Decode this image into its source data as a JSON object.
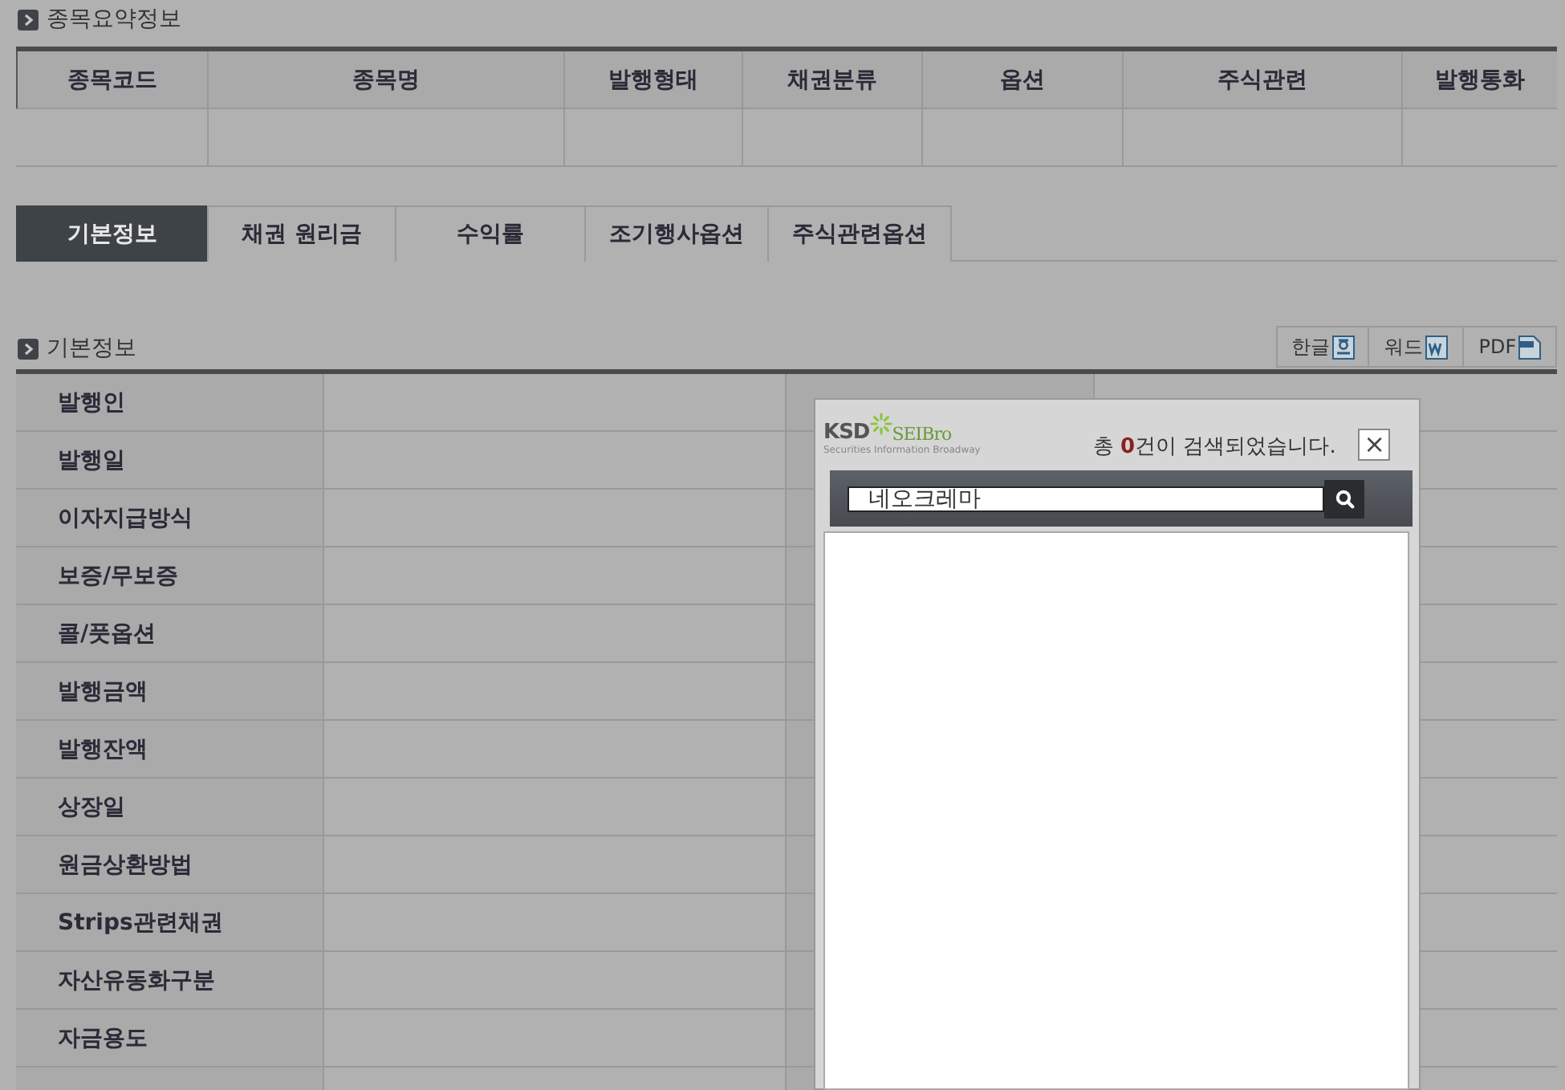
{
  "summary": {
    "title": "종목요약정보",
    "columns": [
      "종목코드",
      "종목명",
      "발행형태",
      "채권분류",
      "옵션",
      "주식관련",
      "발행통화"
    ]
  },
  "tabs": [
    {
      "label": "기본정보",
      "selected": true
    },
    {
      "label": "채권 원리금",
      "selected": false
    },
    {
      "label": "수익률",
      "selected": false
    },
    {
      "label": "조기행사옵션",
      "selected": false
    },
    {
      "label": "주식관련옵션",
      "selected": false
    }
  ],
  "basic_info": {
    "title": "기본정보",
    "exports": [
      {
        "label": "한글",
        "kind": "hwp"
      },
      {
        "label": "워드",
        "kind": "word"
      },
      {
        "label": "PDF",
        "kind": "pdf"
      }
    ],
    "rows": [
      {
        "label": "발행인"
      },
      {
        "label": "발행일"
      },
      {
        "label": "이자지급방식"
      },
      {
        "label": "보증/무보증"
      },
      {
        "label": "콜/풋옵션"
      },
      {
        "label": "발행금액"
      },
      {
        "label": "발행잔액"
      },
      {
        "label": "상장일"
      },
      {
        "label": "원금상환방법"
      },
      {
        "label": "Strips관련채권"
      },
      {
        "label": "자산유동화구분"
      },
      {
        "label": "자금용도"
      }
    ]
  },
  "popup": {
    "logo": {
      "left": "KSD",
      "right": "SEIBro",
      "tagline": "Securities Information Broadway"
    },
    "message": {
      "before": "총 ",
      "count": "0",
      "after": "건이 검색되었습니다."
    },
    "close": "×",
    "search_value": "네오크레마"
  }
}
